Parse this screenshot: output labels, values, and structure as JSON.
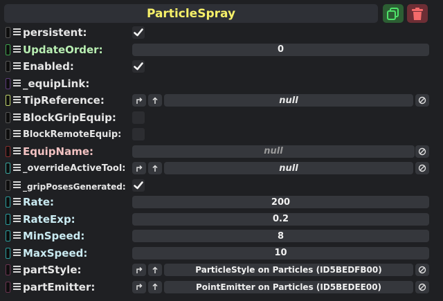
{
  "component": {
    "title": "ParticleSpray",
    "duplicate_icon": "copy-icon",
    "delete_icon": "trash-icon"
  },
  "colors": {
    "title": "#f6f069",
    "label_white": "#e6e6e6",
    "label_green": "#b8eeb2",
    "label_red": "#f2c2c2",
    "label_teal": "#c9eaf1",
    "duplicate_bg": "#2c5e33",
    "delete_bg": "#6d2e35"
  },
  "fields": [
    {
      "label": "persistent:",
      "type": "checkbox",
      "checked": true,
      "indicator": "#555555"
    },
    {
      "label": "UpdateOrder:",
      "type": "value",
      "value": "0",
      "indicator": "#3fa34d",
      "label_color": "green"
    },
    {
      "label": "Enabled:",
      "type": "checkbox",
      "checked": true,
      "indicator": "#555555"
    },
    {
      "label": "_equipLink:",
      "type": "none",
      "indicator": "#5c3a7a"
    },
    {
      "label": "TipReference:",
      "type": "ref",
      "value": "null",
      "indicator": "#bfd36a"
    },
    {
      "label": "BlockGripEquip:",
      "type": "checkbox",
      "checked": false,
      "indicator": "#555555"
    },
    {
      "label": "BlockRemoteEquip:",
      "type": "checkbox",
      "checked": false,
      "indicator": "#555555",
      "small": true
    },
    {
      "label": "EquipName:",
      "type": "string",
      "value": "null",
      "indicator": "#8a2f2f",
      "label_color": "red"
    },
    {
      "label": "_overrideActiveTool:",
      "type": "ref",
      "value": "null",
      "indicator": "#3aa7a0",
      "small": true
    },
    {
      "label": "_gripPosesGenerated:",
      "type": "checkbox",
      "checked": true,
      "indicator": "#555555",
      "xsmall": true
    },
    {
      "label": "Rate:",
      "type": "value",
      "value": "200",
      "indicator": "#2a9d9d",
      "label_color": "teal"
    },
    {
      "label": "RateExp:",
      "type": "value",
      "value": "0.2",
      "indicator": "#2a9d9d",
      "label_color": "teal"
    },
    {
      "label": "MinSpeed:",
      "type": "value",
      "value": "8",
      "indicator": "#2a9d9d",
      "label_color": "teal"
    },
    {
      "label": "MaxSpeed:",
      "type": "value",
      "value": "10",
      "indicator": "#2a9d9d",
      "label_color": "teal"
    },
    {
      "label": "partStyle:",
      "type": "ref",
      "value": "ParticleStyle on Particles (ID5BEDFB00)",
      "indicator": "#6a3350"
    },
    {
      "label": "partEmitter:",
      "type": "ref",
      "value": "PointEmitter on Particles (ID5BEDEE00)",
      "indicator": "#6a3350"
    }
  ]
}
